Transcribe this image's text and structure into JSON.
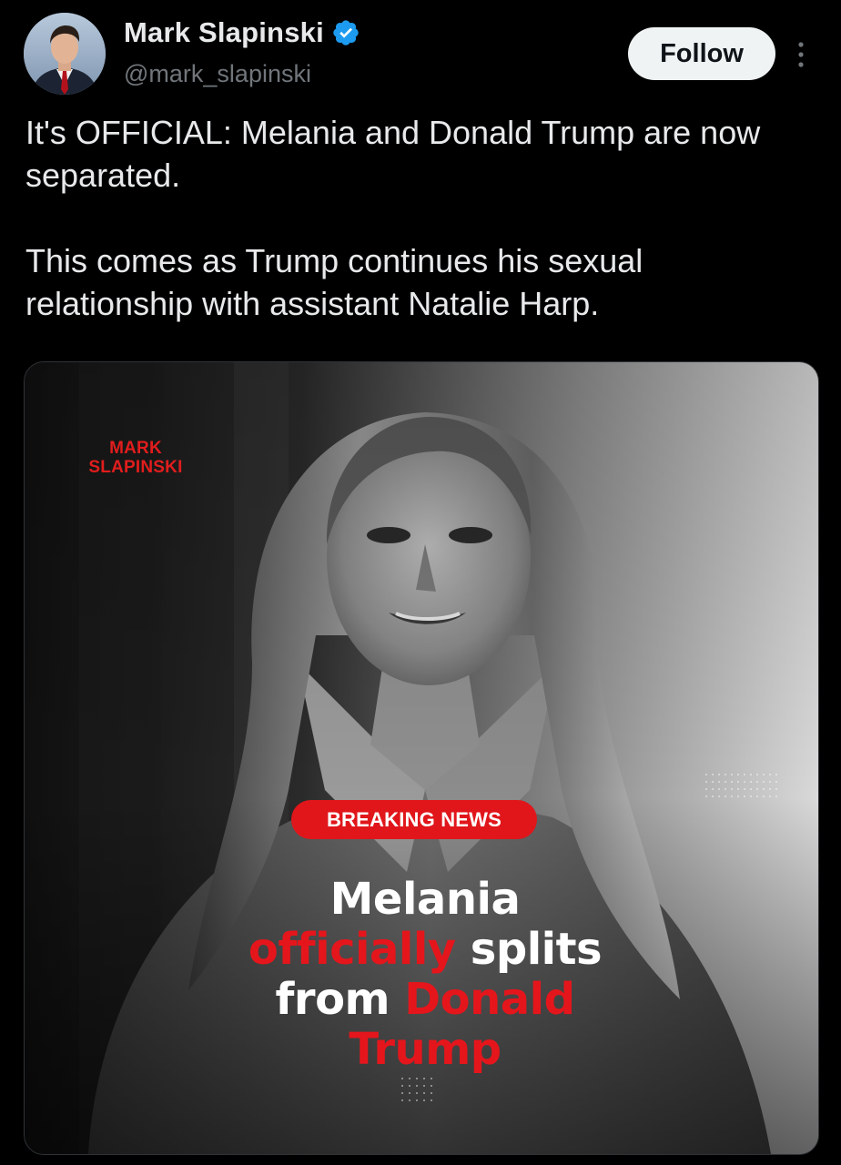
{
  "author": {
    "display_name": "Mark Slapinski",
    "handle": "@mark_slapinski",
    "verified": true,
    "avatar_icon": "profile-photo"
  },
  "actions": {
    "follow_label": "Follow",
    "more_icon": "more-vertical-icon"
  },
  "tweet": {
    "paragraphs": [
      "It's OFFICIAL: Melania and Donald Trump are now separated.",
      "This comes as Trump continues his sexual relationship with assistant Natalie Harp."
    ]
  },
  "media": {
    "watermark": "MARK\nSLAPINSKI",
    "badge": "BREAKING NEWS",
    "headline": {
      "line1": "Melania",
      "line2_red": "officially",
      "line2_white": " splits",
      "line3_white": "from ",
      "line3_red": "Donald",
      "line4_red": "Trump"
    }
  },
  "colors": {
    "background": "#000000",
    "text": "#e7e9ea",
    "secondary_text": "#71767b",
    "verified": "#1d9bf0",
    "accent_red": "#e0161b"
  }
}
